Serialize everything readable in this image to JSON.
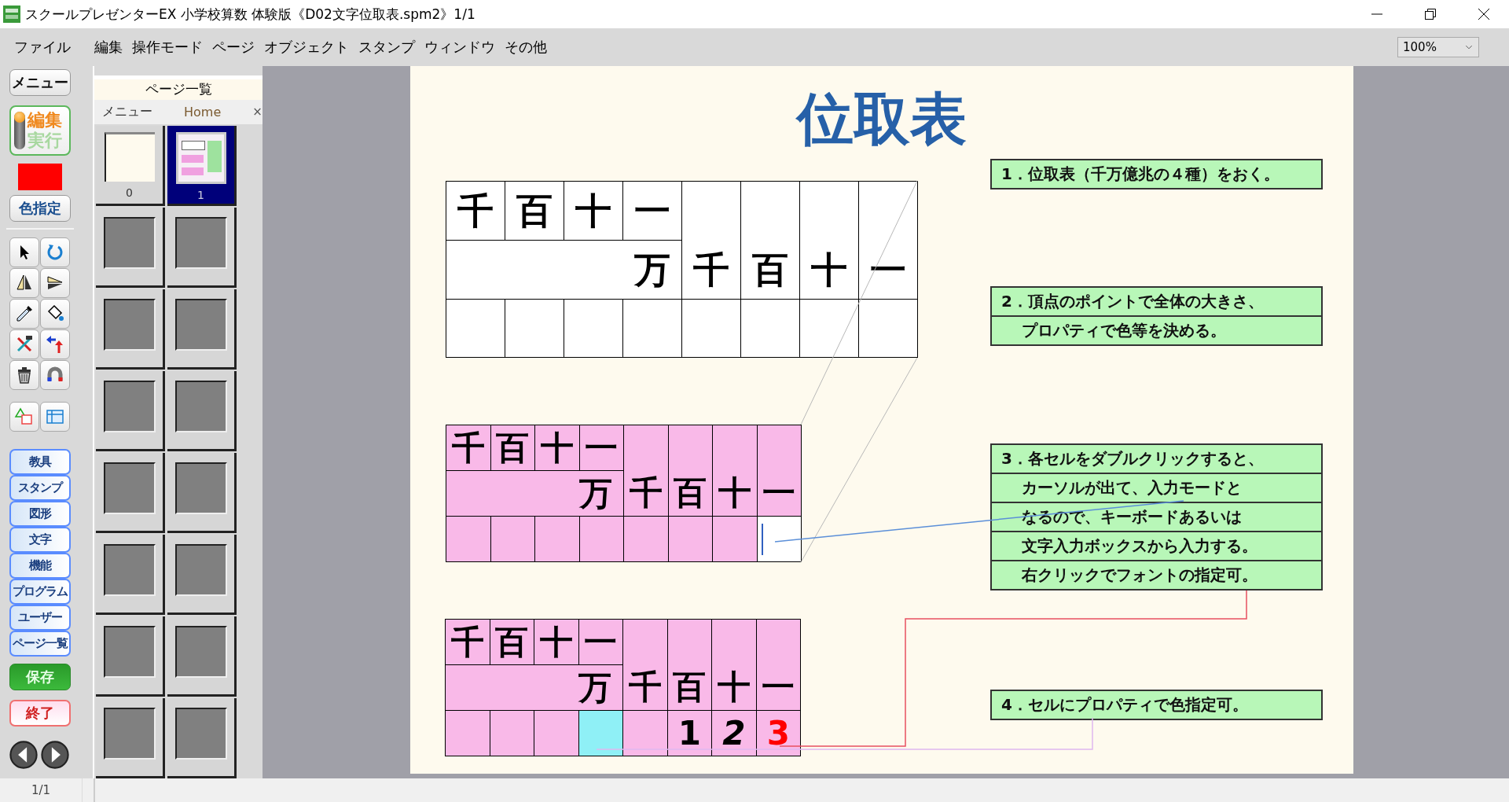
{
  "window": {
    "title": "スクールプレゼンターEX 小学校算数 体験版《D02文字位取表.spm2》1/1"
  },
  "menu": [
    "ファイル",
    "編集",
    "操作モード",
    "ページ",
    "オブジェクト",
    "スタンプ",
    "ウィンドウ",
    "その他"
  ],
  "zoom": {
    "value": "100%"
  },
  "toolbar": {
    "menu_button": "メニュー",
    "mode_toggle": [
      {
        "label": "編集",
        "selected": true
      },
      {
        "label": "実行",
        "selected": false
      }
    ],
    "swatch": {
      "color": "#ff0000"
    },
    "color_button": "色指定",
    "categories": [
      "教具",
      "スタンプ",
      "図形",
      "文字",
      "機能",
      "プログラム",
      "ユーザー",
      "ページ一覧"
    ],
    "save_button": "保存",
    "exit_button": "終了"
  },
  "page_panel": {
    "title": "ページ一覧",
    "tabs": [
      {
        "label": "メニュー",
        "selected": false
      },
      {
        "label": "Home",
        "selected": true
      }
    ],
    "close": "×",
    "pages": [
      {
        "label": "0",
        "selected": false
      },
      {
        "label": "1",
        "selected": true
      }
    ]
  },
  "slide": {
    "title": "位取表",
    "tables": [
      {
        "color": "#ffffff",
        "top_digits": [
          "千",
          "百",
          "十",
          "一"
        ],
        "unit": "万",
        "span_digits": [
          "千",
          "百",
          "十",
          "一"
        ],
        "cells": [
          {
            "kind": "empty"
          },
          {
            "kind": "empty"
          },
          {
            "kind": "empty"
          },
          {
            "kind": "empty"
          },
          {
            "kind": "empty"
          },
          {
            "kind": "empty"
          },
          {
            "kind": "empty"
          },
          {
            "kind": "empty"
          }
        ]
      },
      {
        "color": "#f9b9e8",
        "top_digits": [
          "千",
          "百",
          "十",
          "一"
        ],
        "unit": "万",
        "span_digits": [
          "千",
          "百",
          "十",
          "一"
        ],
        "cells": [
          {
            "kind": "empty"
          },
          {
            "kind": "empty"
          },
          {
            "kind": "empty"
          },
          {
            "kind": "empty"
          },
          {
            "kind": "empty"
          },
          {
            "kind": "empty"
          },
          {
            "kind": "empty"
          },
          {
            "kind": "cursor"
          }
        ]
      },
      {
        "color": "#f9b9e8",
        "top_digits": [
          "千",
          "百",
          "十",
          "一"
        ],
        "unit": "万",
        "span_digits": [
          "千",
          "百",
          "十",
          "一"
        ],
        "cells": [
          {
            "kind": "empty"
          },
          {
            "kind": "empty"
          },
          {
            "kind": "empty"
          },
          {
            "kind": "highlight"
          },
          {
            "kind": "empty"
          },
          {
            "kind": "text",
            "text": "1",
            "color": "#000000"
          },
          {
            "kind": "italic",
            "text": "2",
            "color": "#000000"
          },
          {
            "kind": "text",
            "text": "3",
            "color": "#ff0000"
          }
        ]
      }
    ],
    "notes": [
      {
        "lines": [
          "1．位取表（千万億兆の４種）をおく。"
        ]
      },
      {
        "lines": [
          "2．頂点のポイントで全体の大きさ、",
          "プロパティで色等を決める。"
        ]
      },
      {
        "lines": [
          "3．各セルをダブルクリックすると、",
          "カーソルが出て、入力モードと",
          "なるので、キーボードあるいは",
          "文字入力ボックスから入力する。",
          "右クリックでフォントの指定可。"
        ]
      },
      {
        "lines": [
          "4．セルにプロパティで色指定可。"
        ]
      }
    ]
  },
  "status_bar": {
    "page": "1/1"
  }
}
